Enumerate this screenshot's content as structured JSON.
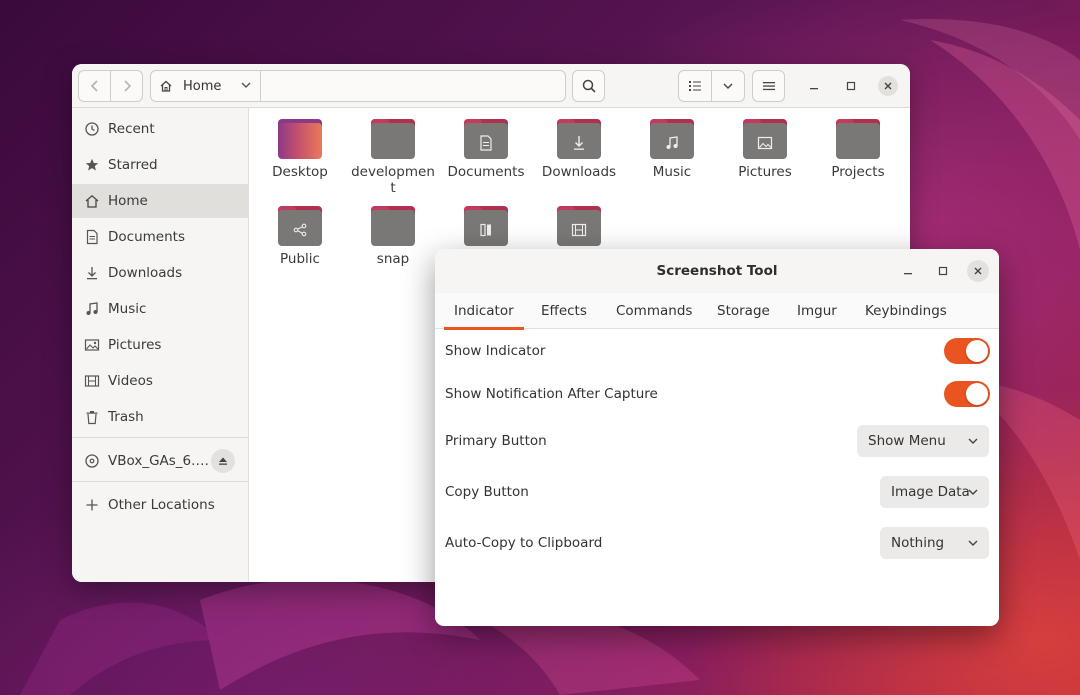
{
  "files_window": {
    "path": {
      "location": "Home"
    },
    "sidebar": {
      "items": [
        {
          "label": "Recent",
          "icon": "clock-icon"
        },
        {
          "label": "Starred",
          "icon": "star-icon"
        },
        {
          "label": "Home",
          "icon": "home-icon",
          "active": true
        },
        {
          "label": "Documents",
          "icon": "document-icon"
        },
        {
          "label": "Downloads",
          "icon": "download-icon"
        },
        {
          "label": "Music",
          "icon": "music-icon"
        },
        {
          "label": "Pictures",
          "icon": "picture-icon"
        },
        {
          "label": "Videos",
          "icon": "film-icon"
        },
        {
          "label": "Trash",
          "icon": "trash-icon"
        }
      ],
      "device": {
        "label": "VBox_GAs_6.…",
        "icon": "disc-icon"
      },
      "other_locations": {
        "label": "Other Locations",
        "icon": "plus-icon"
      }
    },
    "folders": [
      {
        "label": "Desktop",
        "icon": "desktop-folder-icon"
      },
      {
        "label": "development",
        "icon": "folder-icon"
      },
      {
        "label": "Documents",
        "icon": "documents-folder-icon"
      },
      {
        "label": "Downloads",
        "icon": "downloads-folder-icon"
      },
      {
        "label": "Music",
        "icon": "music-folder-icon"
      },
      {
        "label": "Pictures",
        "icon": "pictures-folder-icon"
      },
      {
        "label": "Projects",
        "icon": "folder-icon"
      },
      {
        "label": "Public",
        "icon": "share-folder-icon"
      },
      {
        "label": "snap",
        "icon": "folder-icon"
      },
      {
        "label": "",
        "icon": "templates-folder-icon"
      },
      {
        "label": "",
        "icon": "videos-folder-icon"
      }
    ]
  },
  "screenshot_window": {
    "title": "Screenshot Tool",
    "tabs": [
      "Indicator",
      "Effects",
      "Commands",
      "Storage",
      "Imgur",
      "Keybindings"
    ],
    "active_tab": "Indicator",
    "settings": {
      "show_indicator": {
        "label": "Show Indicator",
        "enabled": true
      },
      "show_notification": {
        "label": "Show Notification After Capture",
        "enabled": true
      },
      "primary_button": {
        "label": "Primary Button",
        "value": "Show Menu"
      },
      "copy_button": {
        "label": "Copy Button",
        "value": "Image Data"
      },
      "auto_copy": {
        "label": "Auto-Copy to Clipboard",
        "value": "Nothing"
      }
    }
  },
  "colors": {
    "accent": "#e95420",
    "folder_tab": "#b0304f",
    "folder_body": "#7a7876"
  }
}
